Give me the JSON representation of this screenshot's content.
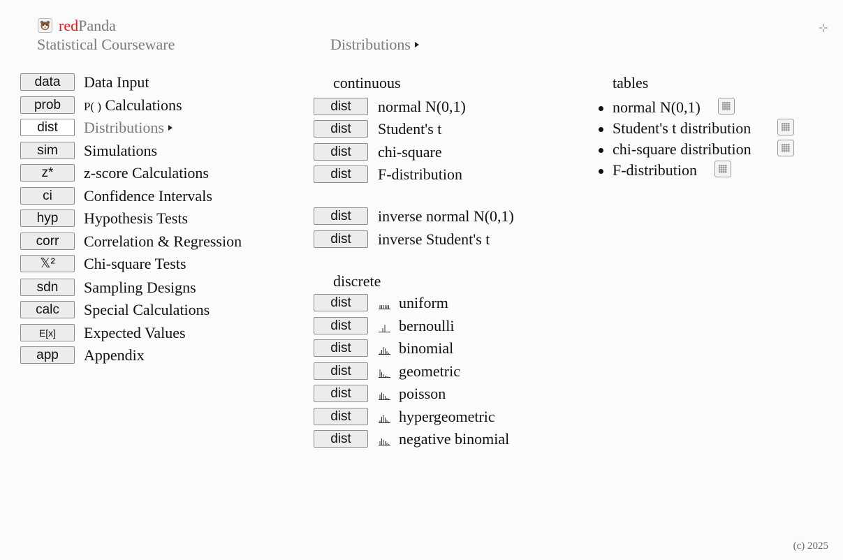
{
  "header": {
    "brand_red": "red",
    "brand_rest": "Panda",
    "subtitle": "Statistical Courseware",
    "breadcrumb": "Distributions"
  },
  "sidebar": {
    "items": [
      {
        "button": "data",
        "label": "Data Input"
      },
      {
        "button": "prob",
        "label_prefix": "P( )",
        "label": "Calculations"
      },
      {
        "button": "dist",
        "label": "Distributions",
        "active": true
      },
      {
        "button": "sim",
        "label": "Simulations"
      },
      {
        "button": "z*",
        "label": "z-score Calculations"
      },
      {
        "button": "ci",
        "label": "Confidence Intervals"
      },
      {
        "button": "hyp",
        "label": "Hypothesis Tests"
      },
      {
        "button": "corr",
        "label": "Correlation & Regression"
      },
      {
        "button": "𝕏²",
        "label": "Chi-square Tests"
      },
      {
        "button": "sdn",
        "label": "Sampling Designs"
      },
      {
        "button": "calc",
        "label": "Special Calculations"
      },
      {
        "button": "E[x]",
        "label": "Expected Values"
      },
      {
        "button": "app",
        "label": "Appendix"
      }
    ]
  },
  "continuous": {
    "heading": "continuous",
    "items": [
      {
        "button": "dist",
        "label": "normal N(0,1)"
      },
      {
        "button": "dist",
        "label": "Student's t"
      },
      {
        "button": "dist",
        "label": "chi-square"
      },
      {
        "button": "dist",
        "label": "F-distribution"
      },
      {
        "button": "dist",
        "label": "inverse normal N(0,1)"
      },
      {
        "button": "dist",
        "label": "inverse Student's t"
      }
    ]
  },
  "discrete": {
    "heading": "discrete",
    "items": [
      {
        "button": "dist",
        "label": "uniform",
        "icon": "uniform-histogram-icon"
      },
      {
        "button": "dist",
        "label": "bernoulli",
        "icon": "bernoulli-histogram-icon"
      },
      {
        "button": "dist",
        "label": "binomial",
        "icon": "binomial-histogram-icon"
      },
      {
        "button": "dist",
        "label": "geometric",
        "icon": "geometric-histogram-icon"
      },
      {
        "button": "dist",
        "label": "poisson",
        "icon": "poisson-histogram-icon"
      },
      {
        "button": "dist",
        "label": "hypergeometric",
        "icon": "hypergeometric-histogram-icon"
      },
      {
        "button": "dist",
        "label": "negative binomial",
        "icon": "negative-binomial-histogram-icon"
      }
    ]
  },
  "tables": {
    "heading": "tables",
    "items": [
      {
        "label": "normal N(0,1)"
      },
      {
        "label": "Student's t distribution"
      },
      {
        "label": "chi-square distribution"
      },
      {
        "label": "F-distribution"
      }
    ]
  },
  "footer": {
    "copyright": "(c) 2025"
  },
  "colors": {
    "brand_red": "#e0191f",
    "muted_gray": "#7a7a7a",
    "button_bg": "#ececec"
  }
}
